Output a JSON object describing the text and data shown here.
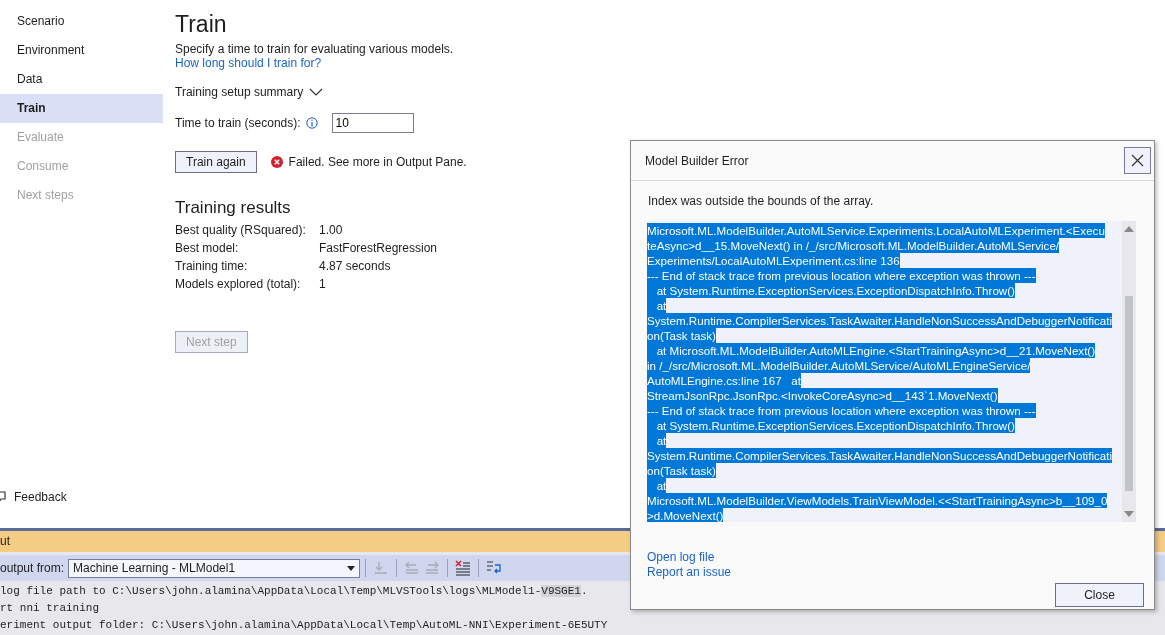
{
  "sidebar": {
    "items": [
      {
        "label": "Scenario",
        "selected": false,
        "disabled": false
      },
      {
        "label": "Environment",
        "selected": false,
        "disabled": false
      },
      {
        "label": "Data",
        "selected": false,
        "disabled": false
      },
      {
        "label": "Train",
        "selected": true,
        "disabled": false
      },
      {
        "label": "Evaluate",
        "selected": false,
        "disabled": true
      },
      {
        "label": "Consume",
        "selected": false,
        "disabled": true
      },
      {
        "label": "Next steps",
        "selected": false,
        "disabled": true
      }
    ],
    "feedback": "Feedback"
  },
  "main": {
    "title": "Train",
    "description": "Specify a time to train for evaluating various models.",
    "help_link": "How long should I train for?",
    "summary": {
      "label": "Training setup summary",
      "expanded": false
    },
    "time_field": {
      "label": "Time to train (seconds):",
      "value": "10"
    },
    "train_button": "Train again",
    "status": "Failed. See more in Output Pane.",
    "results_title": "Training results",
    "results": [
      {
        "label": "Best quality (RSquared):",
        "value": "1.00"
      },
      {
        "label": "Best model:",
        "value": "FastForestRegression"
      },
      {
        "label": "Training time:",
        "value": "4.87 seconds"
      },
      {
        "label": "Models explored (total):",
        "value": "1"
      }
    ],
    "next_button": {
      "label": "Next step",
      "disabled": true
    }
  },
  "output": {
    "title": "ut",
    "source_label": "output from:",
    "source": "Machine Learning - MLModel1",
    "lines": [
      {
        "text": "log file path to C:\\Users\\john.alamina\\AppData\\Local\\Temp\\MLVSTools\\logs\\MLModel1-",
        "highlight": "V9SGE1",
        "tail": "."
      },
      {
        "text": "rt nni training"
      },
      {
        "text": "eriment output folder: C:\\Users\\john.alamina\\AppData\\Local\\Temp\\AutoML-NNI\\Experiment-6E5UTY"
      }
    ]
  },
  "dialog": {
    "title": "Model Builder Error",
    "message": "Index was outside the bounds of the array.",
    "trace": [
      "Microsoft.ML.ModelBuilder.AutoMLService.Experiments.LocalAutoMLExperiment.<Execu",
      "teAsync>d__15.MoveNext() in /_/src/Microsoft.ML.ModelBuilder.AutoMLService/",
      "Experiments/LocalAutoMLExperiment.cs:line 136",
      "--- End of stack trace from previous location where exception was thrown ---",
      "   at System.Runtime.ExceptionServices.ExceptionDispatchInfo.Throw()",
      "   at",
      "System.Runtime.CompilerServices.TaskAwaiter.HandleNonSuccessAndDebuggerNotificati",
      "on(Task task)",
      "   at Microsoft.ML.ModelBuilder.AutoMLEngine.<StartTrainingAsync>d__21.MoveNext()",
      "in /_/src/Microsoft.ML.ModelBuilder.AutoMLService/AutoMLEngineService/",
      "AutoMLEngine.cs:line 167   at",
      "StreamJsonRpc.JsonRpc.<InvokeCoreAsync>d__143`1.MoveNext()",
      "--- End of stack trace from previous location where exception was thrown ---",
      "   at System.Runtime.ExceptionServices.ExceptionDispatchInfo.Throw()",
      "   at",
      "System.Runtime.CompilerServices.TaskAwaiter.HandleNonSuccessAndDebuggerNotificati",
      "on(Task task)",
      "   at",
      "Microsoft.ML.ModelBuilder.ViewModels.TrainViewModel.<<StartTrainingAsync>b__109_0",
      ">d.MoveNext()"
    ],
    "links": [
      "Open log file",
      "Report an issue"
    ],
    "close_button": "Close"
  }
}
